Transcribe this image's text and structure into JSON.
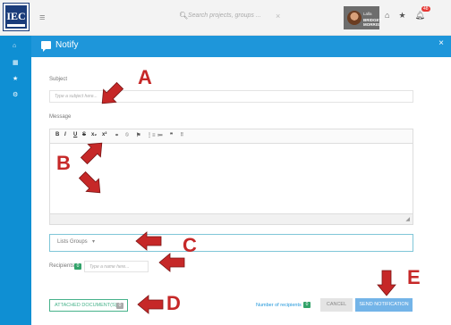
{
  "header": {
    "logo_text": "IEC",
    "search_placeholder": "Search projects, groups ...",
    "search_clear": "×",
    "user_name": "Lalla",
    "user_org": "BRIDGET MORRIS",
    "notification_count": "48"
  },
  "modal": {
    "title": "Notify",
    "close": "×",
    "subject_label": "Subject",
    "subject_placeholder": "Type a subject here...",
    "message_label": "Message",
    "toolbar": [
      "B",
      "I",
      "U",
      "S",
      "x₂",
      "x²",
      "⚭",
      "⦸",
      "⚑",
      "⋮≡",
      "≔",
      "❞",
      "⦙⦙"
    ],
    "lists_groups": "Lists Groups",
    "recipients_label": "Recipients",
    "recipients_count": "0",
    "recipients_placeholder": "Type a name here...",
    "attach_label": "ATTACHED DOCUMENT(S)",
    "attach_count": "0",
    "number_of_recipients_label": "Number of recipients",
    "number_of_recipients": "0",
    "cancel_label": "CANCEL",
    "send_label": "SEND NOTIFICATION"
  },
  "callouts": [
    "A",
    "B",
    "C",
    "D",
    "E"
  ],
  "colors": {
    "primary": "#1e96da",
    "sidebar": "#0f8fd3",
    "annotation": "#c62828",
    "success": "#33a36a"
  }
}
